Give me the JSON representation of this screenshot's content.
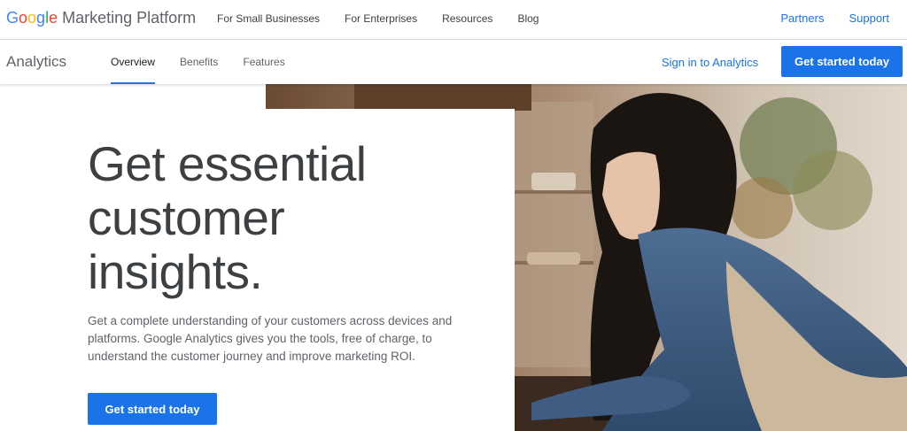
{
  "brand": {
    "logo_letters": [
      {
        "char": "G",
        "color": "#4285f4"
      },
      {
        "char": "o",
        "color": "#ea4335"
      },
      {
        "char": "o",
        "color": "#fbbc05"
      },
      {
        "char": "g",
        "color": "#4285f4"
      },
      {
        "char": "l",
        "color": "#34a853"
      },
      {
        "char": "e",
        "color": "#ea4335"
      }
    ],
    "name": "Marketing Platform"
  },
  "top_nav": {
    "items": [
      "For Small Businesses",
      "For Enterprises",
      "Resources",
      "Blog"
    ],
    "right_links": [
      "Partners",
      "Support"
    ]
  },
  "sub_nav": {
    "product": "Analytics",
    "tabs": [
      {
        "label": "Overview",
        "active": true
      },
      {
        "label": "Benefits",
        "active": false
      },
      {
        "label": "Features",
        "active": false
      }
    ],
    "sign_in": "Sign in to Analytics",
    "cta": "Get started today"
  },
  "hero": {
    "headline_lines": [
      "Get essential",
      "customer",
      "insights."
    ],
    "description_lines": [
      "Get a complete understanding of your customers across devices and",
      "platforms. Google Analytics gives you the tools, free of charge, to",
      "understand the customer journey and improve marketing ROI."
    ],
    "cta": "Get started today",
    "image": "woman-in-denim-shirt-at-shop-counter"
  },
  "colors": {
    "accent": "#1a73e8",
    "text": "#3c4043",
    "muted": "#5f6368"
  }
}
